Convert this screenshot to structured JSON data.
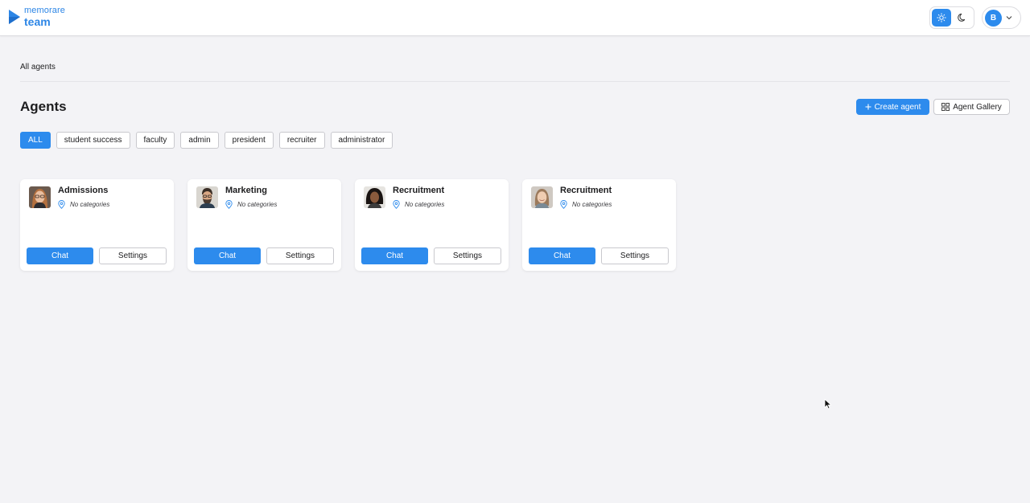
{
  "brand": {
    "line1": "memorare",
    "line2": "team",
    "color": "#2d86e6"
  },
  "header": {
    "theme_toggle": {
      "light_icon": "sun-icon",
      "dark_icon": "moon-icon",
      "active": "light"
    },
    "user": {
      "initial": "B",
      "menu_icon": "chevron-down-icon"
    }
  },
  "breadcrumb": "All agents",
  "page": {
    "title": "Agents",
    "create_label": "Create agent",
    "gallery_label": "Agent Gallery"
  },
  "filters": [
    {
      "label": "ALL",
      "active": true
    },
    {
      "label": "student success",
      "active": false
    },
    {
      "label": "faculty",
      "active": false
    },
    {
      "label": "admin",
      "active": false
    },
    {
      "label": "president",
      "active": false
    },
    {
      "label": "recruiter",
      "active": false
    },
    {
      "label": "administrator",
      "active": false
    }
  ],
  "agents": [
    {
      "name": "Admissions",
      "categories": "No categories",
      "chat_label": "Chat",
      "settings_label": "Settings",
      "avatar": "woman-glasses-portrait"
    },
    {
      "name": "Marketing",
      "categories": "No categories",
      "chat_label": "Chat",
      "settings_label": "Settings",
      "avatar": "man-beard-portrait"
    },
    {
      "name": "Recruitment",
      "categories": "No categories",
      "chat_label": "Chat",
      "settings_label": "Settings",
      "avatar": "woman-curly-hair-portrait"
    },
    {
      "name": "Recruitment",
      "categories": "No categories",
      "chat_label": "Chat",
      "settings_label": "Settings",
      "avatar": "woman-smiling-portrait"
    }
  ],
  "colors": {
    "accent": "#2d8bed",
    "background": "#f3f3f6",
    "card": "#ffffff",
    "border": "#c9c9ce"
  }
}
